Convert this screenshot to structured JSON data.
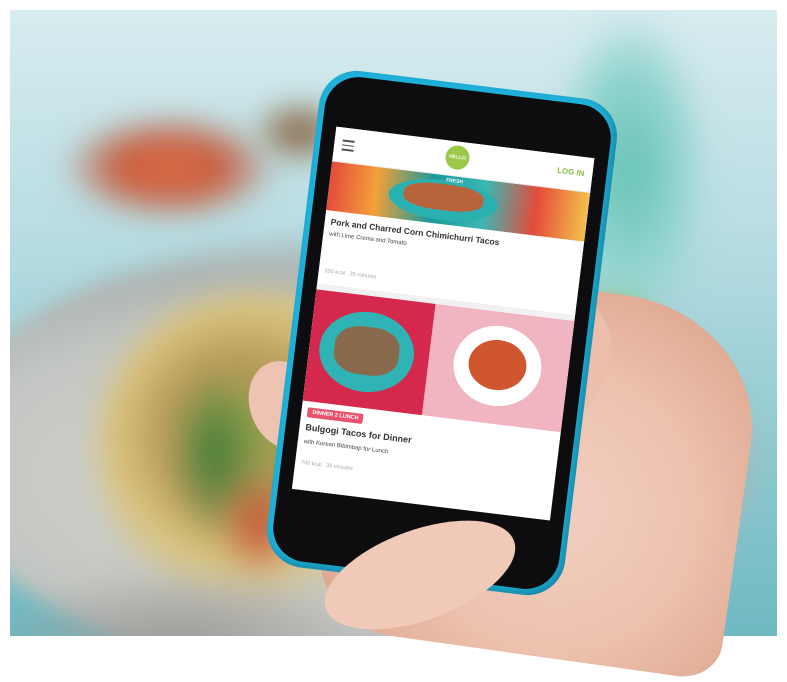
{
  "app": {
    "logo_text": "HELLO FRESH",
    "login_label": "LOG IN"
  },
  "recipes": [
    {
      "title": "Pork and Charred Corn Chimichurri Tacos",
      "subtitle": "with Lime Crema and Tomato",
      "calories": "550 kcal",
      "time": "35 minutes"
    },
    {
      "badge": "DINNER 2 LUNCH",
      "title": "Bulgogi Tacos for Dinner",
      "subtitle": "with Korean Bibimbap for Lunch",
      "calories": "700 kcal",
      "time": "35 minutes"
    }
  ],
  "colors": {
    "phone_case": "#1fb3dc",
    "accent_green": "#8bc34a",
    "badge_pink": "#e8526b"
  }
}
